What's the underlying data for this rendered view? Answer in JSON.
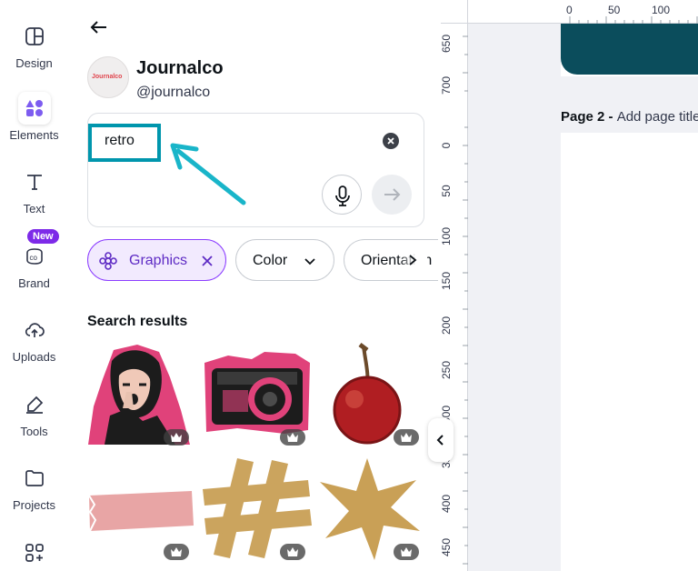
{
  "rail": {
    "items": [
      {
        "label": "Design",
        "icon": "design-icon"
      },
      {
        "label": "Elements",
        "icon": "elements-icon"
      },
      {
        "label": "Text",
        "icon": "text-icon"
      },
      {
        "label": "Brand",
        "icon": "brand-icon"
      },
      {
        "label": "Uploads",
        "icon": "uploads-icon"
      },
      {
        "label": "Tools",
        "icon": "tools-icon"
      },
      {
        "label": "Projects",
        "icon": "projects-icon"
      },
      {
        "label": "",
        "icon": "apps-icon"
      }
    ],
    "new_badge": "New"
  },
  "panel": {
    "brand_logo_text": "Journalco",
    "brand_name": "Journalco",
    "brand_handle": "@journalco",
    "search": {
      "value": "retro"
    },
    "chips": [
      {
        "label": "Graphics",
        "active": true
      },
      {
        "label": "Color"
      },
      {
        "label": "Orientation"
      }
    ],
    "section_title": "Search results",
    "results": [
      {
        "name": "retro-woman-graphic"
      },
      {
        "name": "retro-camera-graphic"
      },
      {
        "name": "cherry-graphic"
      },
      {
        "name": "pink-tape-graphic"
      },
      {
        "name": "hashtag-tape-graphic"
      },
      {
        "name": "star-burst-graphic"
      }
    ]
  },
  "canvas": {
    "ruler_top": [
      "0",
      "50",
      "100"
    ],
    "ruler_left": [
      "650",
      "700",
      "0",
      "50",
      "100",
      "150",
      "200",
      "250",
      "300",
      "350",
      "400",
      "450"
    ],
    "page2_label": "Page 2 - ",
    "page2_placeholder": "Add page title"
  },
  "colors": {
    "accent": "#8b3dff",
    "annotation": "#0096ad",
    "page_fill": "#0b4d5c"
  }
}
